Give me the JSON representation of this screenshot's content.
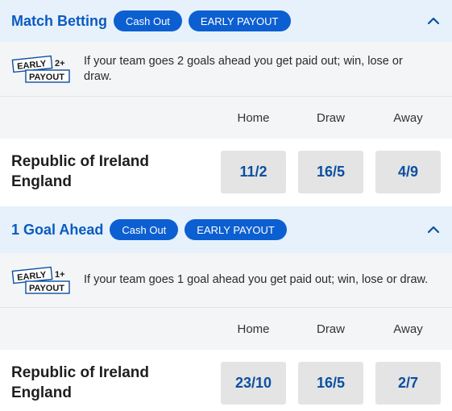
{
  "markets": [
    {
      "title": "Match Betting",
      "badges": [
        "Cash Out",
        "EARLY PAYOUT"
      ],
      "promo": {
        "badge_top": "EARLY",
        "badge_num": "2+",
        "badge_bottom": "PAYOUT",
        "text": "If your team goes 2 goals ahead you get paid out; win, lose or draw."
      },
      "columns": [
        "Home",
        "Draw",
        "Away"
      ],
      "event": {
        "home": "Republic of Ireland",
        "away": "England"
      },
      "prices": [
        "11/2",
        "16/5",
        "4/9"
      ]
    },
    {
      "title": "1 Goal Ahead",
      "badges": [
        "Cash Out",
        "EARLY PAYOUT"
      ],
      "promo": {
        "badge_top": "EARLY",
        "badge_num": "1+",
        "badge_bottom": "PAYOUT",
        "text": "If your team goes 1 goal ahead you get paid out; win, lose or draw."
      },
      "columns": [
        "Home",
        "Draw",
        "Away"
      ],
      "event": {
        "home": "Republic of Ireland",
        "away": "England"
      },
      "prices": [
        "23/10",
        "16/5",
        "2/7"
      ]
    }
  ],
  "colors": {
    "accent": "#0c5fd1",
    "header_bg": "#e6f1fc",
    "price_bg": "#e4e4e4",
    "price_text": "#0b4fa0"
  },
  "icons": {
    "collapse": "chevron-up-icon"
  }
}
